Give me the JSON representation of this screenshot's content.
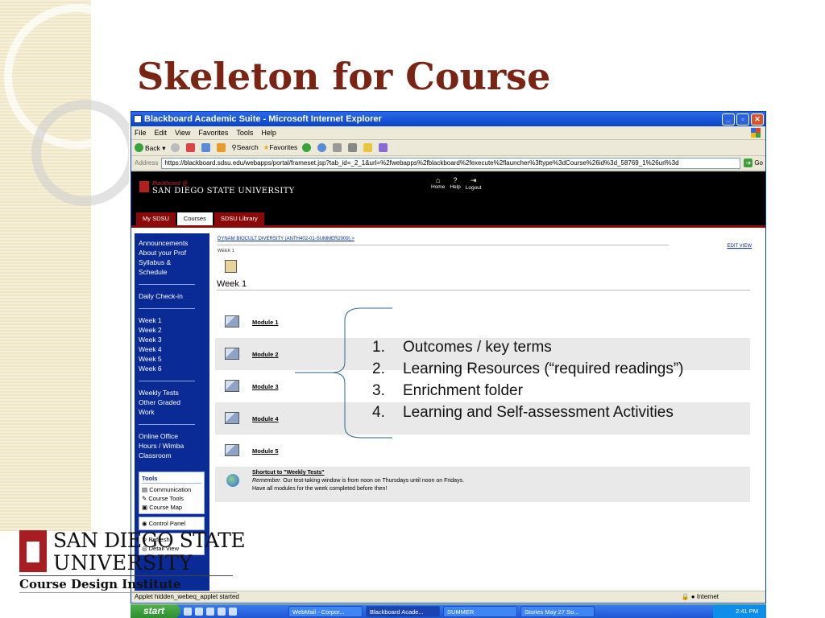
{
  "slide": {
    "title": "Skeleton for Course"
  },
  "browser": {
    "window_title": "Blackboard Academic Suite - Microsoft Internet Explorer",
    "menu": [
      "File",
      "Edit",
      "View",
      "Favorites",
      "Tools",
      "Help"
    ],
    "toolbar": {
      "back": "Back",
      "search": "Search",
      "favorites": "Favorites"
    },
    "address": {
      "label": "Address",
      "url": "https://blackboard.sdsu.edu/webapps/portal/frameset.jsp?tab_id=_2_1&url=%2fwebapps%2fblackboard%2fexecute%2flauncher%3ftype%3dCourse%26id%3d_58769_1%26url%3d",
      "go": "Go"
    },
    "status": "Applet hidden_webeq_applet started",
    "zone": "Internet"
  },
  "blackboard": {
    "brand": "Blackboard @",
    "university": "SAN DIEGO STATE UNIVERSITY",
    "nav": [
      "Home",
      "Help",
      "Logout"
    ],
    "tabs": [
      "My SDSU",
      "Courses",
      "SDSU Library"
    ],
    "active_tab": "Courses",
    "breadcrumb": "DYNAM BIOCULT DIVERSITY (ANTH402-01-SUMMER2009) >",
    "breadcrumb_sub": "WEEK 1",
    "edit_view": "EDIT VIEW",
    "sidebar": {
      "groups": [
        [
          "Announcements",
          "About your Prof",
          "Syllabus &",
          "Schedule"
        ],
        [
          "Daily Check-in"
        ],
        [
          "Week 1",
          "Week 2",
          "Week 3",
          "Week 4",
          "Week 5",
          "Week 6"
        ],
        [
          "Weekly Tests",
          "Other Graded",
          "Work"
        ],
        [
          "Online Office",
          "Hours / Wimba",
          "Classroom"
        ]
      ],
      "tools_heading": "Tools",
      "tools": [
        "Communication",
        "Course Tools",
        "Course Map"
      ],
      "control_panel": "Control Panel",
      "refresh": "Refresh",
      "detail_view": "Detail View"
    },
    "week_heading": "Week 1",
    "modules": [
      "Module 1",
      "Module 2",
      "Module 3",
      "Module 4",
      "Module 5"
    ],
    "shortcut": {
      "title": "Shortcut to \"Weekly Tests\"",
      "lead": "Remember.",
      "desc": " Our test-taking window is from noon on Thursdays until noon on Fridays.",
      "desc2": "Have all modules for the week completed before then!"
    }
  },
  "taskbar": {
    "start": "start",
    "tasks": [
      "WebMail - Corpor...",
      "Blackboard Acade...",
      "SUMMER",
      "Stories May 27 So..."
    ],
    "active_task": "Blackboard Acade...",
    "clock": "2:41 PM"
  },
  "annotation": {
    "items": [
      {
        "num": "1.",
        "text": "Outcomes / key terms"
      },
      {
        "num": "2.",
        "text": "Learning Resources (“required readings”)"
      },
      {
        "num": "3.",
        "text": "Enrichment folder"
      },
      {
        "num": "4.",
        "text": "Learning and Self-assessment Activities"
      }
    ]
  },
  "logo": {
    "line1": "SAN DIEGO STATE",
    "line2": "UNIVERSITY",
    "subtitle": "Course Design Institute"
  },
  "colors": {
    "title": "#7a2414",
    "sidebar": "#0a2b96",
    "tab_red": "#8a0a0a",
    "xp_blue": "#0843c8"
  }
}
